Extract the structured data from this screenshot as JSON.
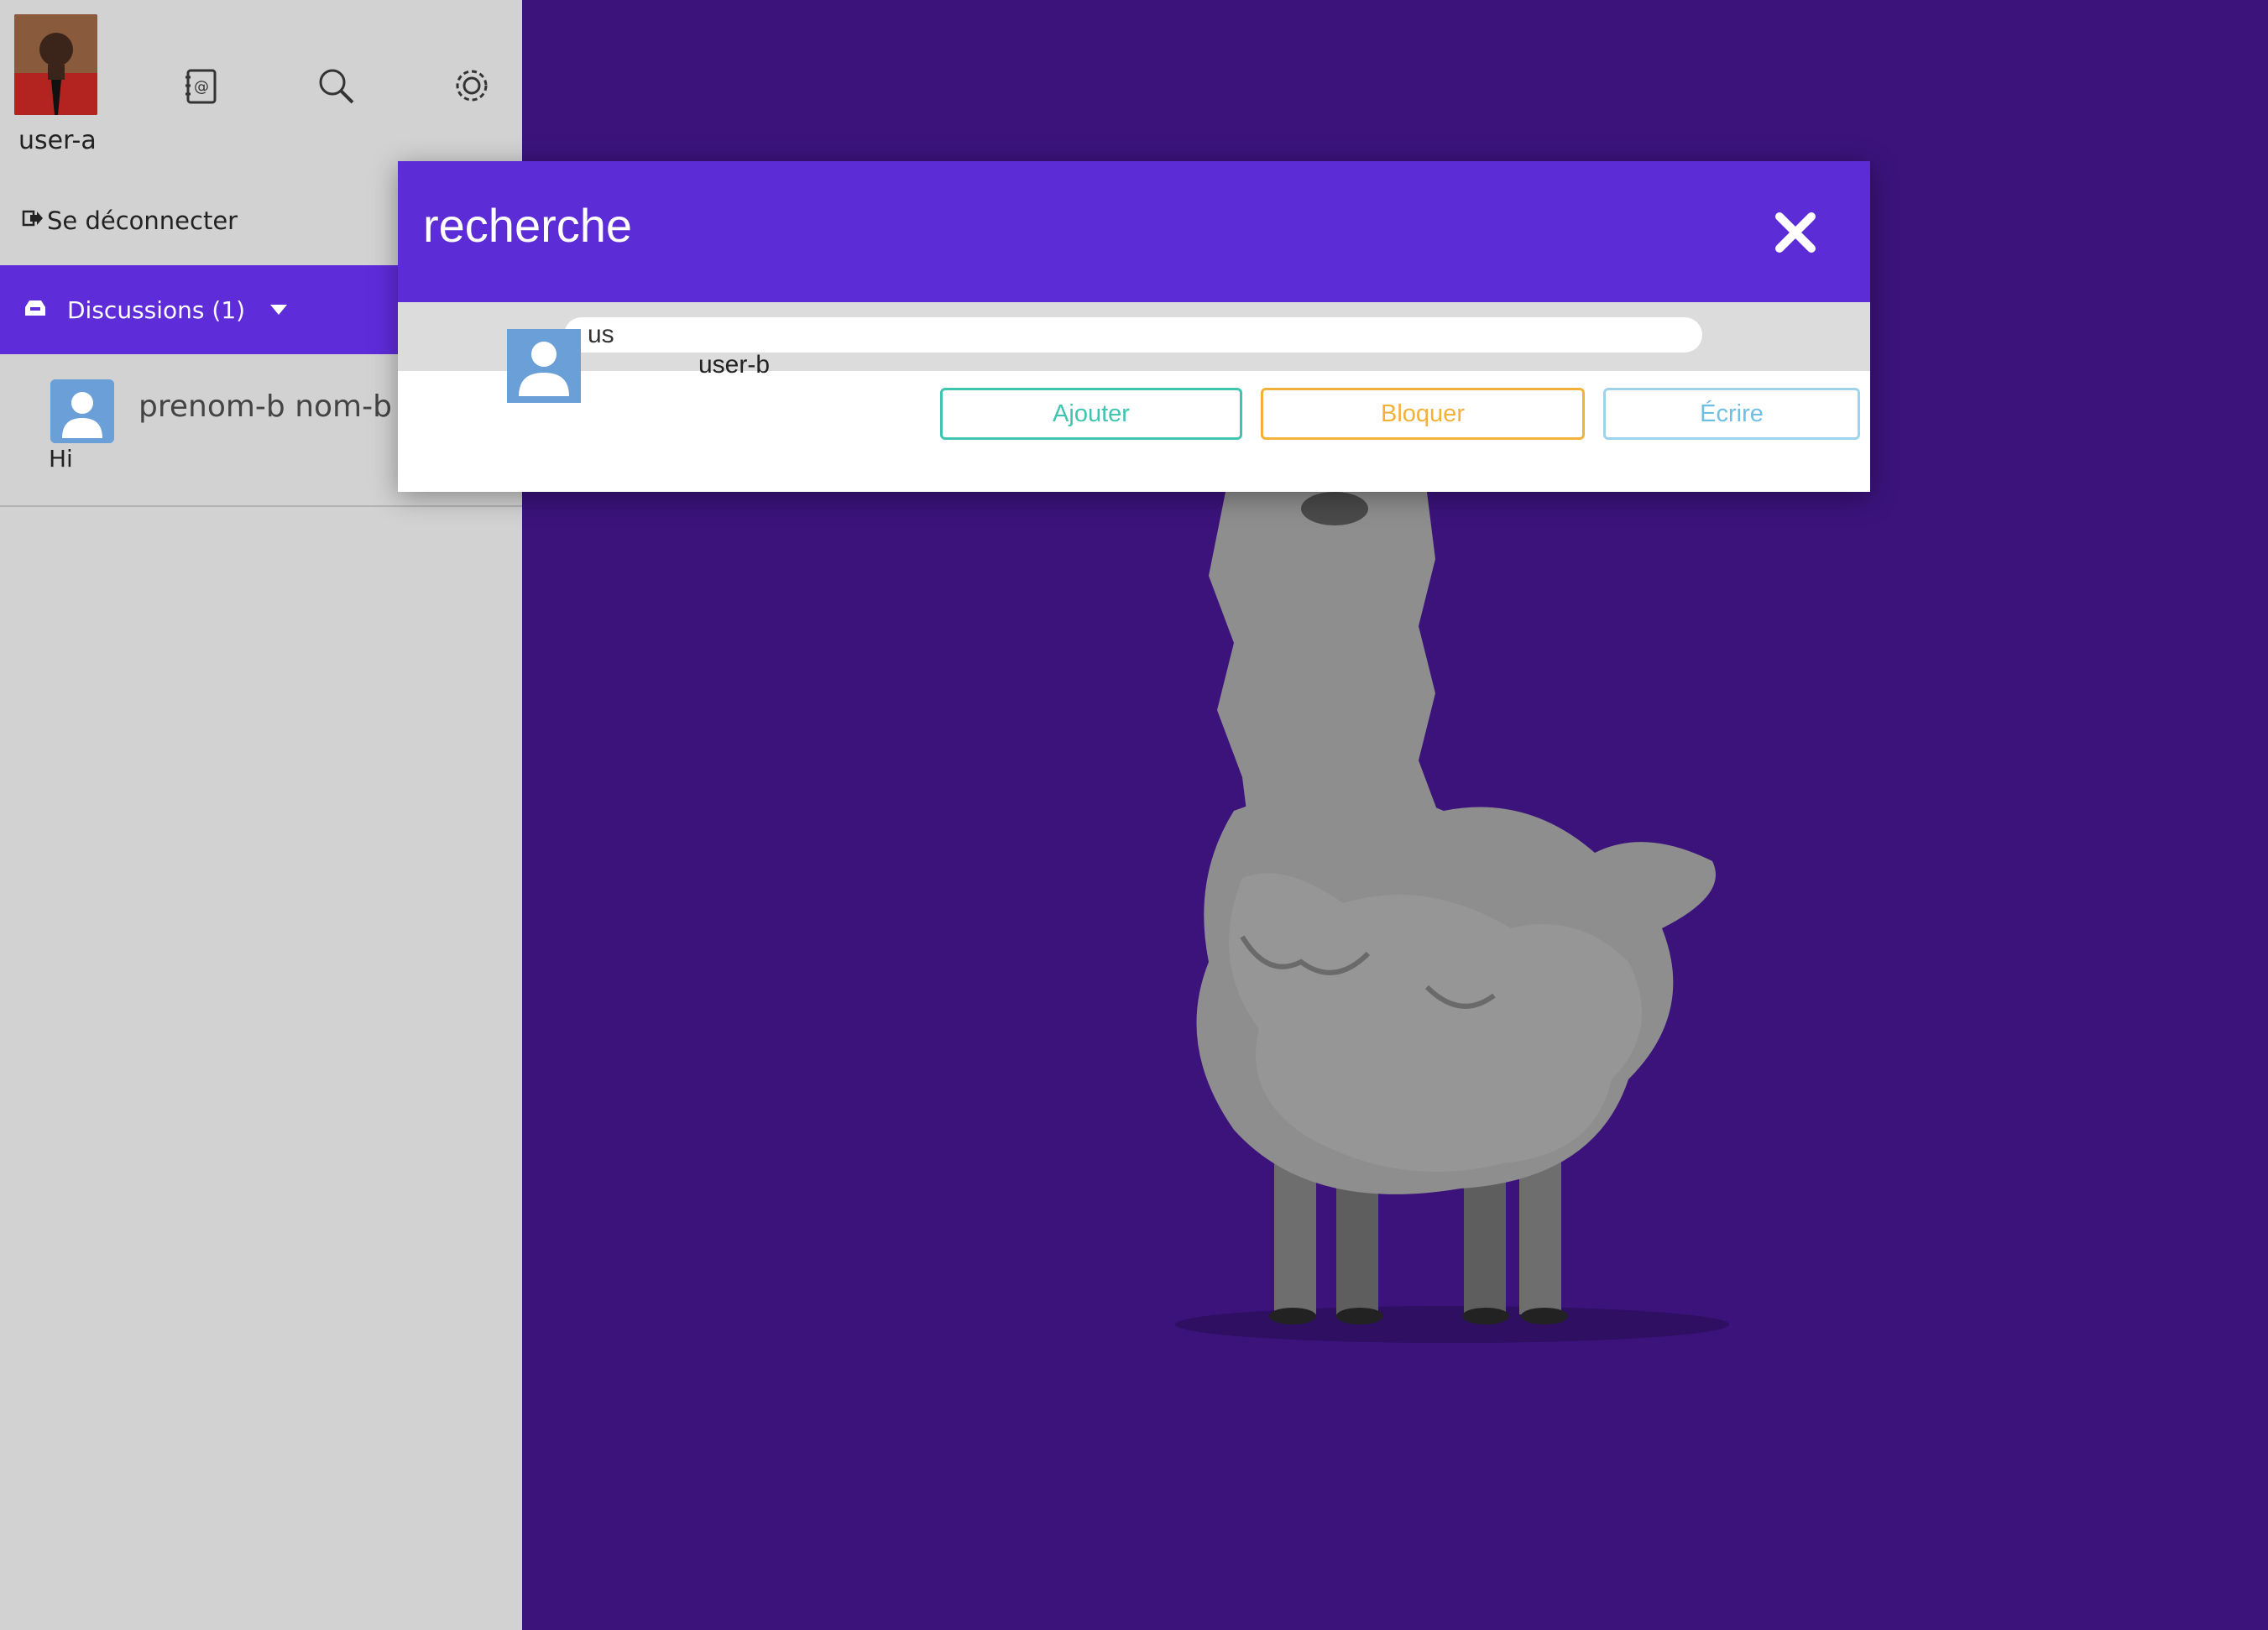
{
  "sidebar": {
    "username": "user-a",
    "logout_label": "Se déconnecter",
    "tools": [
      "contacts-icon",
      "search-icon",
      "settings-icon"
    ],
    "discussions_label": "Discussions (1)",
    "conversations": [
      {
        "name": "prenom-b nom-b",
        "preview": "Hi"
      }
    ]
  },
  "modal": {
    "title": "recherche",
    "search_value": "us",
    "results": [
      {
        "name": "user-b",
        "add_label": "Ajouter",
        "block_label": "Bloquer",
        "write_label": "Écrire"
      }
    ]
  },
  "colors": {
    "brand_purple": "#5c2cd6",
    "background": "#3b137b",
    "sidebar_bg": "#d2d2d2",
    "add": "#3fc4b0",
    "block": "#f2b23a",
    "write": "#6fbfe4"
  }
}
